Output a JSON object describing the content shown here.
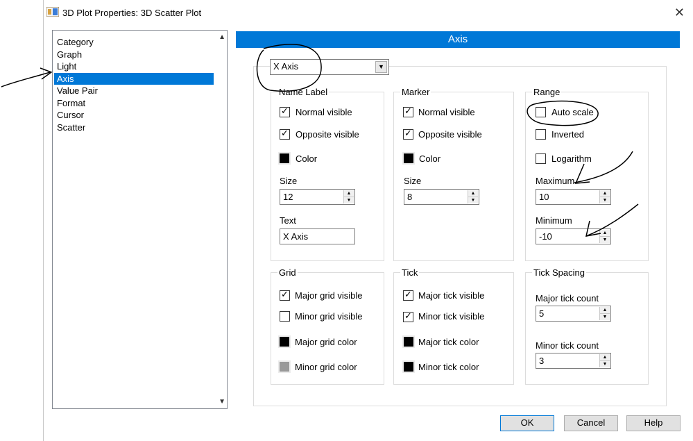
{
  "window": {
    "title": "3D Plot Properties: 3D Scatter Plot",
    "close_glyph": "✕"
  },
  "category": {
    "items": [
      "Category",
      "Graph",
      "Light",
      "Axis",
      "Value Pair",
      "Format",
      "Cursor",
      "Scatter"
    ],
    "selected": "Axis"
  },
  "header": {
    "title": "Axis"
  },
  "axis_select": {
    "value": "X Axis"
  },
  "name_label": {
    "title": "Name Label",
    "normal_visible": "Normal visible",
    "opposite_visible": "Opposite visible",
    "color": "Color",
    "size_label": "Size",
    "size_value": "12",
    "text_label": "Text",
    "text_value": "X Axis"
  },
  "marker": {
    "title": "Marker",
    "normal_visible": "Normal visible",
    "opposite_visible": "Opposite visible",
    "color": "Color",
    "size_label": "Size",
    "size_value": "8"
  },
  "range": {
    "title": "Range",
    "auto_scale": "Auto scale",
    "inverted": "Inverted",
    "logarithm": "Logarithm",
    "maximum_label": "Maximum",
    "maximum_value": "10",
    "minimum_label": "Minimum",
    "minimum_value": "-10"
  },
  "grid": {
    "title": "Grid",
    "major_visible": "Major grid visible",
    "minor_visible": "Minor grid visible",
    "major_color": "Major grid color",
    "minor_color": "Minor grid color"
  },
  "tick": {
    "title": "Tick",
    "major_visible": "Major tick visible",
    "minor_visible": "Minor tick visible",
    "major_color": "Major tick color",
    "minor_color": "Minor tick color"
  },
  "tick_spacing": {
    "title": "Tick Spacing",
    "major_count_label": "Major tick count",
    "major_count_value": "5",
    "minor_count_label": "Minor tick count",
    "minor_count_value": "3"
  },
  "buttons": {
    "ok": "OK",
    "cancel": "Cancel",
    "help": "Help"
  },
  "glyphs": {
    "check": "✓",
    "up": "▲",
    "down": "▼",
    "spin_up": "▲",
    "spin_down": "▼"
  },
  "colors": {
    "accent": "#0078d7",
    "black_swatch": "#000000",
    "gray_swatch": "#999999"
  }
}
